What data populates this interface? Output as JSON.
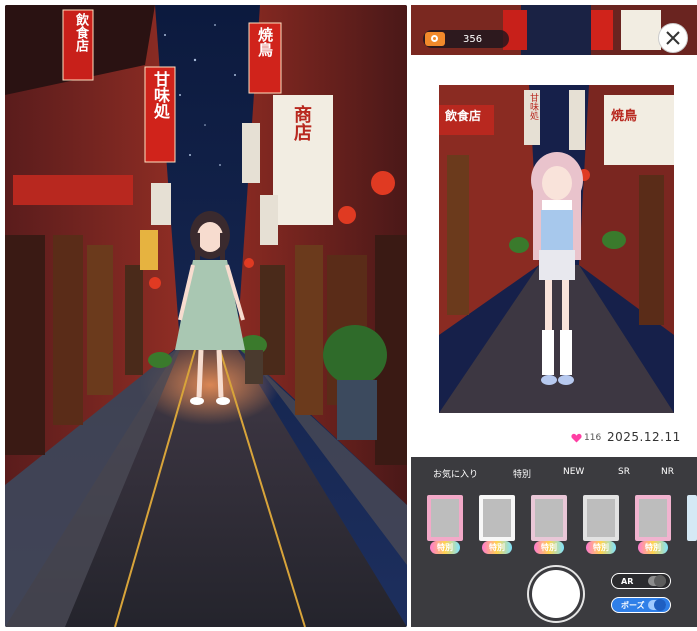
{
  "left_view": {
    "signs": [
      "飲食店",
      "甘味処",
      "焼鳥",
      "商店"
    ]
  },
  "right_view": {
    "coin_count": "356",
    "likes": "116",
    "date": "2025.12.11",
    "photo_signs": [
      "飲食店",
      "甘味処",
      "焼鳥"
    ],
    "tabs": [
      "お気に入り",
      "特別",
      "NEW",
      "SR",
      "NR"
    ],
    "thumbnails": [
      {
        "badge": "特別",
        "frame": "#f3a9c8"
      },
      {
        "badge": "特別",
        "frame": "#f7f7f7"
      },
      {
        "badge": "特別",
        "frame": "#e9c7d7"
      },
      {
        "badge": "特別",
        "frame": "#e2e2e2"
      },
      {
        "badge": "特別",
        "frame": "#f1b3cf"
      }
    ],
    "toggles": {
      "ar_label": "AR",
      "pose_label": "ポーズ"
    }
  },
  "colors": {
    "panel": "#3b3b3f",
    "accent_blue": "#2f7fe8",
    "heart": "#ff3fa4"
  }
}
